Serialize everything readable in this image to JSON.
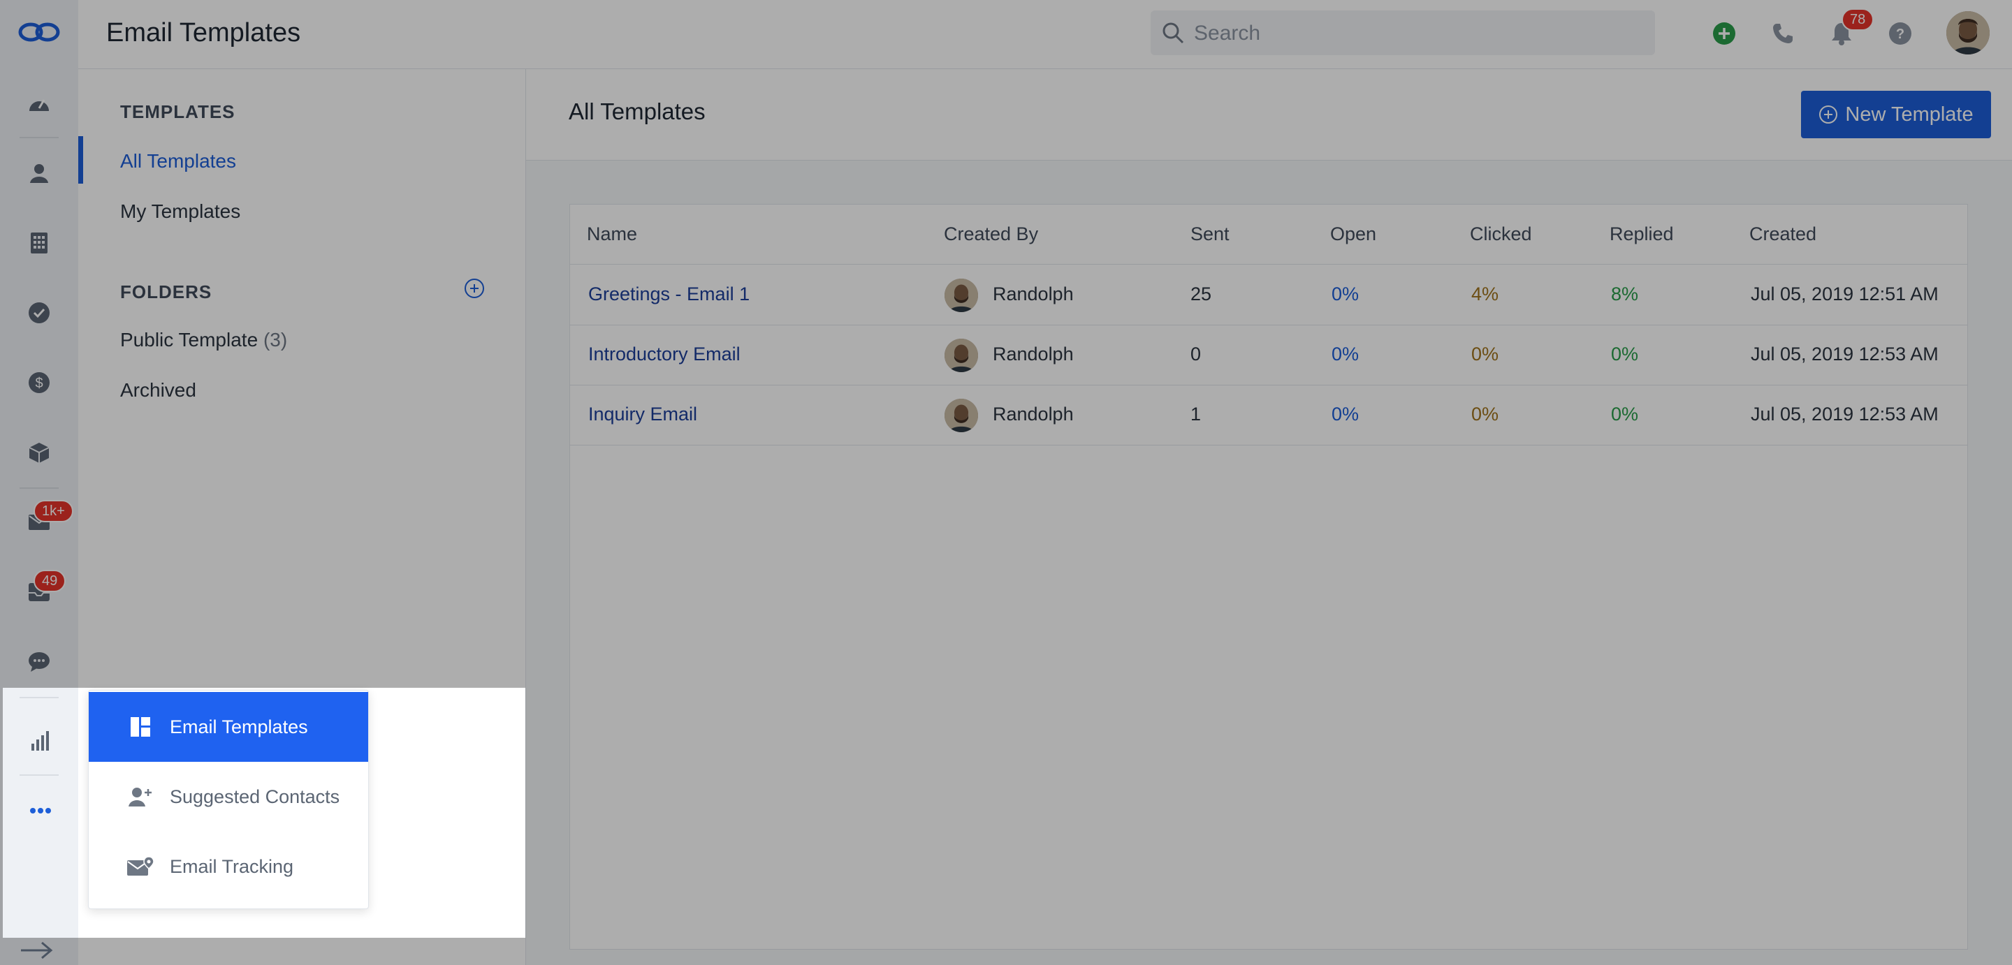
{
  "app": {
    "page_title": "Email Templates"
  },
  "colors": {
    "accent": "#1d5ed8",
    "badge": "#e5332a",
    "open": "#1d5ed8",
    "clicked": "#a0731d",
    "replied": "#2a9d4a"
  },
  "leftnav": {
    "items": [
      {
        "icon": "logo-icon"
      },
      {
        "icon": "dashboard-icon"
      },
      {
        "icon": "contacts-icon"
      },
      {
        "icon": "company-icon"
      },
      {
        "icon": "tasks-icon"
      },
      {
        "icon": "deals-icon"
      },
      {
        "icon": "products-icon"
      },
      {
        "icon": "email-icon",
        "badge": "1k+"
      },
      {
        "icon": "inbox-icon",
        "badge": "49"
      },
      {
        "icon": "chat-icon"
      },
      {
        "icon": "reports-icon"
      },
      {
        "icon": "more-icon"
      }
    ]
  },
  "topbar": {
    "search_placeholder": "Search",
    "notifications_badge": "78",
    "icons": [
      "add-icon",
      "phone-icon",
      "bell-icon",
      "help-icon",
      "avatar"
    ]
  },
  "subnav": {
    "templates_title": "TEMPLATES",
    "all_templates": "All Templates",
    "my_templates": "My Templates",
    "folders_title": "FOLDERS",
    "public_template": "Public Template",
    "public_count": "(3)",
    "archived": "Archived"
  },
  "content": {
    "title": "All Templates",
    "new_button": "New Template",
    "columns": [
      "Name",
      "Created By",
      "Sent",
      "Open",
      "Clicked",
      "Replied",
      "Created"
    ],
    "rows": [
      {
        "name": "Greetings - Email 1",
        "created_by": "Randolph",
        "sent": "25",
        "open": "0%",
        "clicked": "4%",
        "replied": "8%",
        "created": "Jul 05, 2019 12:51 AM"
      },
      {
        "name": "Introductory Email",
        "created_by": "Randolph",
        "sent": "0",
        "open": "0%",
        "clicked": "0%",
        "replied": "0%",
        "created": "Jul 05, 2019 12:53 AM"
      },
      {
        "name": "Inquiry Email",
        "created_by": "Randolph",
        "sent": "1",
        "open": "0%",
        "clicked": "0%",
        "replied": "0%",
        "created": "Jul 05, 2019 12:53 AM"
      }
    ]
  },
  "popup_menu": {
    "items": [
      {
        "label": "Email Templates",
        "icon": "templates-icon",
        "active": true
      },
      {
        "label": "Suggested Contacts",
        "icon": "add-contact-icon",
        "active": false
      },
      {
        "label": "Email Tracking",
        "icon": "email-tracking-icon",
        "active": false
      }
    ]
  }
}
